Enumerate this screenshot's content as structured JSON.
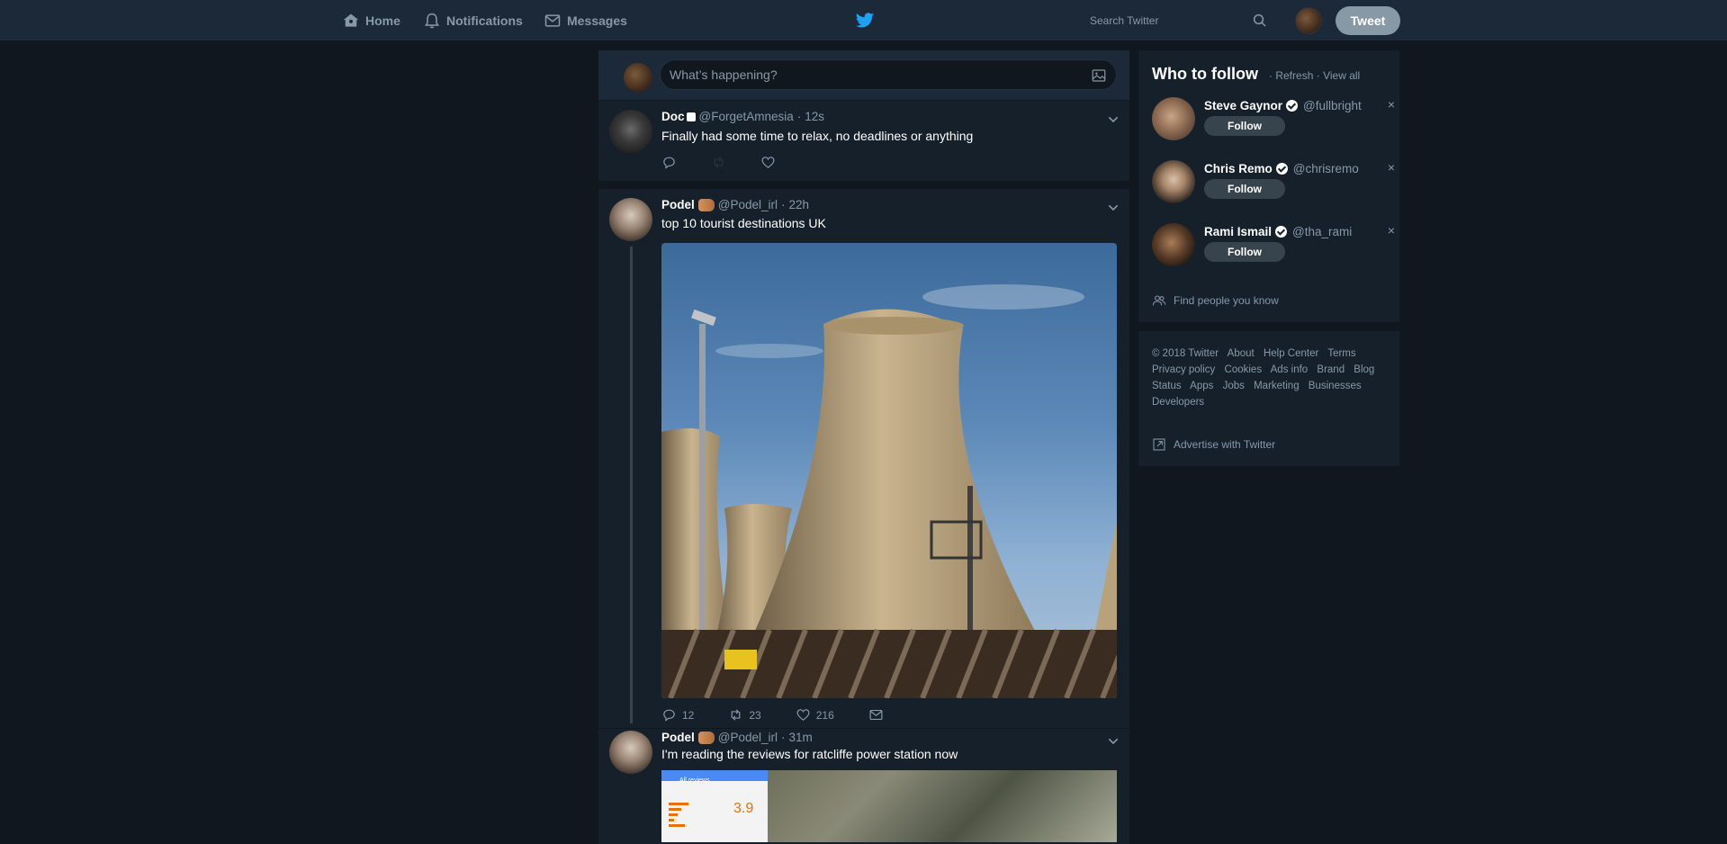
{
  "nav": {
    "home": "Home",
    "notifications": "Notifications",
    "messages": "Messages",
    "search_placeholder": "Search Twitter",
    "tweet_button": "Tweet"
  },
  "composer": {
    "placeholder": "What’s happening?"
  },
  "tweets": [
    {
      "name": "Doc",
      "handle": "@ForgetAmnesia",
      "time": "12s",
      "text": "Finally had some time to relax, no deadlines or anything"
    },
    {
      "name": "Podel",
      "handle": "@Podel_irl",
      "time": "22h",
      "text": "top 10 tourist destinations UK",
      "replies": "12",
      "retweets": "23",
      "likes": "216"
    },
    {
      "name": "Podel",
      "handle": "@Podel_irl",
      "time": "31m",
      "text": "I'm reading the reviews for ratcliffe power station now",
      "media_rating": "3.9",
      "media_header": "All reviews"
    }
  ],
  "who_to_follow": {
    "title": "Who to follow",
    "separator": "·",
    "refresh": "Refresh",
    "view_all": "View all",
    "users": [
      {
        "name": "Steve Gaynor",
        "handle": "@fullbright",
        "follow": "Follow"
      },
      {
        "name": "Chris Remo",
        "handle": "@chrisremo",
        "follow": "Follow"
      },
      {
        "name": "Rami Ismail",
        "handle": "@tha_rami",
        "follow": "Follow"
      }
    ],
    "find_people": "Find people you know"
  },
  "footer": {
    "links": [
      "© 2018 Twitter",
      "About",
      "Help Center",
      "Terms",
      "Privacy policy",
      "Cookies",
      "Ads info",
      "Brand",
      "Blog",
      "Status",
      "Apps",
      "Jobs",
      "Marketing",
      "Businesses",
      "Developers"
    ],
    "advertise": "Advertise with Twitter"
  },
  "colors": {
    "background": "#10171e",
    "panel": "#15202b",
    "header": "#1c2938",
    "muted_text": "#8899a6",
    "twitter_blue": "#1da1f2"
  }
}
